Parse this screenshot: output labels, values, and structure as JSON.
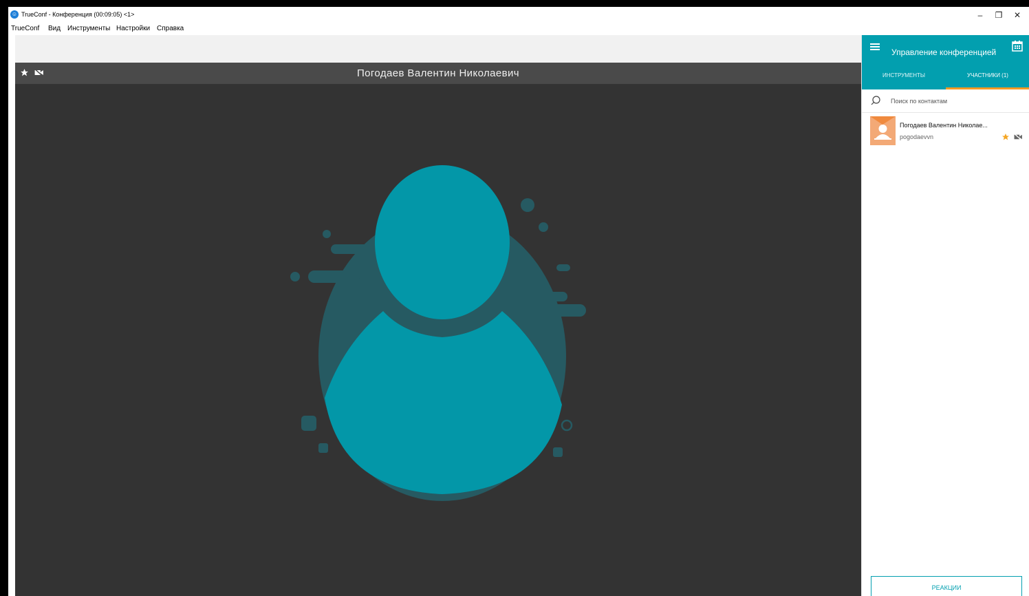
{
  "window": {
    "title": "TrueConf - Конференция (00:09:05) <1>",
    "controls": {
      "minimize": "–",
      "restore": "❐",
      "close": "✕"
    }
  },
  "menu": [
    "TrueConf",
    "Вид",
    "Инструменты",
    "Настройки",
    "Справка"
  ],
  "video": {
    "participant_name": "Погодаев Валентин Николаевич",
    "icons": [
      "star-icon",
      "camera-off-icon",
      "person-placeholder-icon"
    ]
  },
  "panel": {
    "title": "Управление конференцией",
    "tabs": [
      {
        "label": "ИНСТРУМЕНТЫ",
        "active": false
      },
      {
        "label": "УЧАСТНИКИ (1)",
        "active": true
      }
    ],
    "search": {
      "placeholder": "Поиск по контактам",
      "value": ""
    },
    "participants": [
      {
        "name": "Погодаев Валентин Николае...",
        "login": "pogodaevvn",
        "favorite": true,
        "camera": "off"
      }
    ],
    "reactions_label": "РЕАКЦИИ"
  },
  "colors": {
    "accent": "#029faf",
    "tab_indicator": "#f59a23",
    "video_bg": "#333333",
    "avatar_teal": "#0397a8",
    "avatar_shadow": "#265a62",
    "star": "#f5a623"
  }
}
